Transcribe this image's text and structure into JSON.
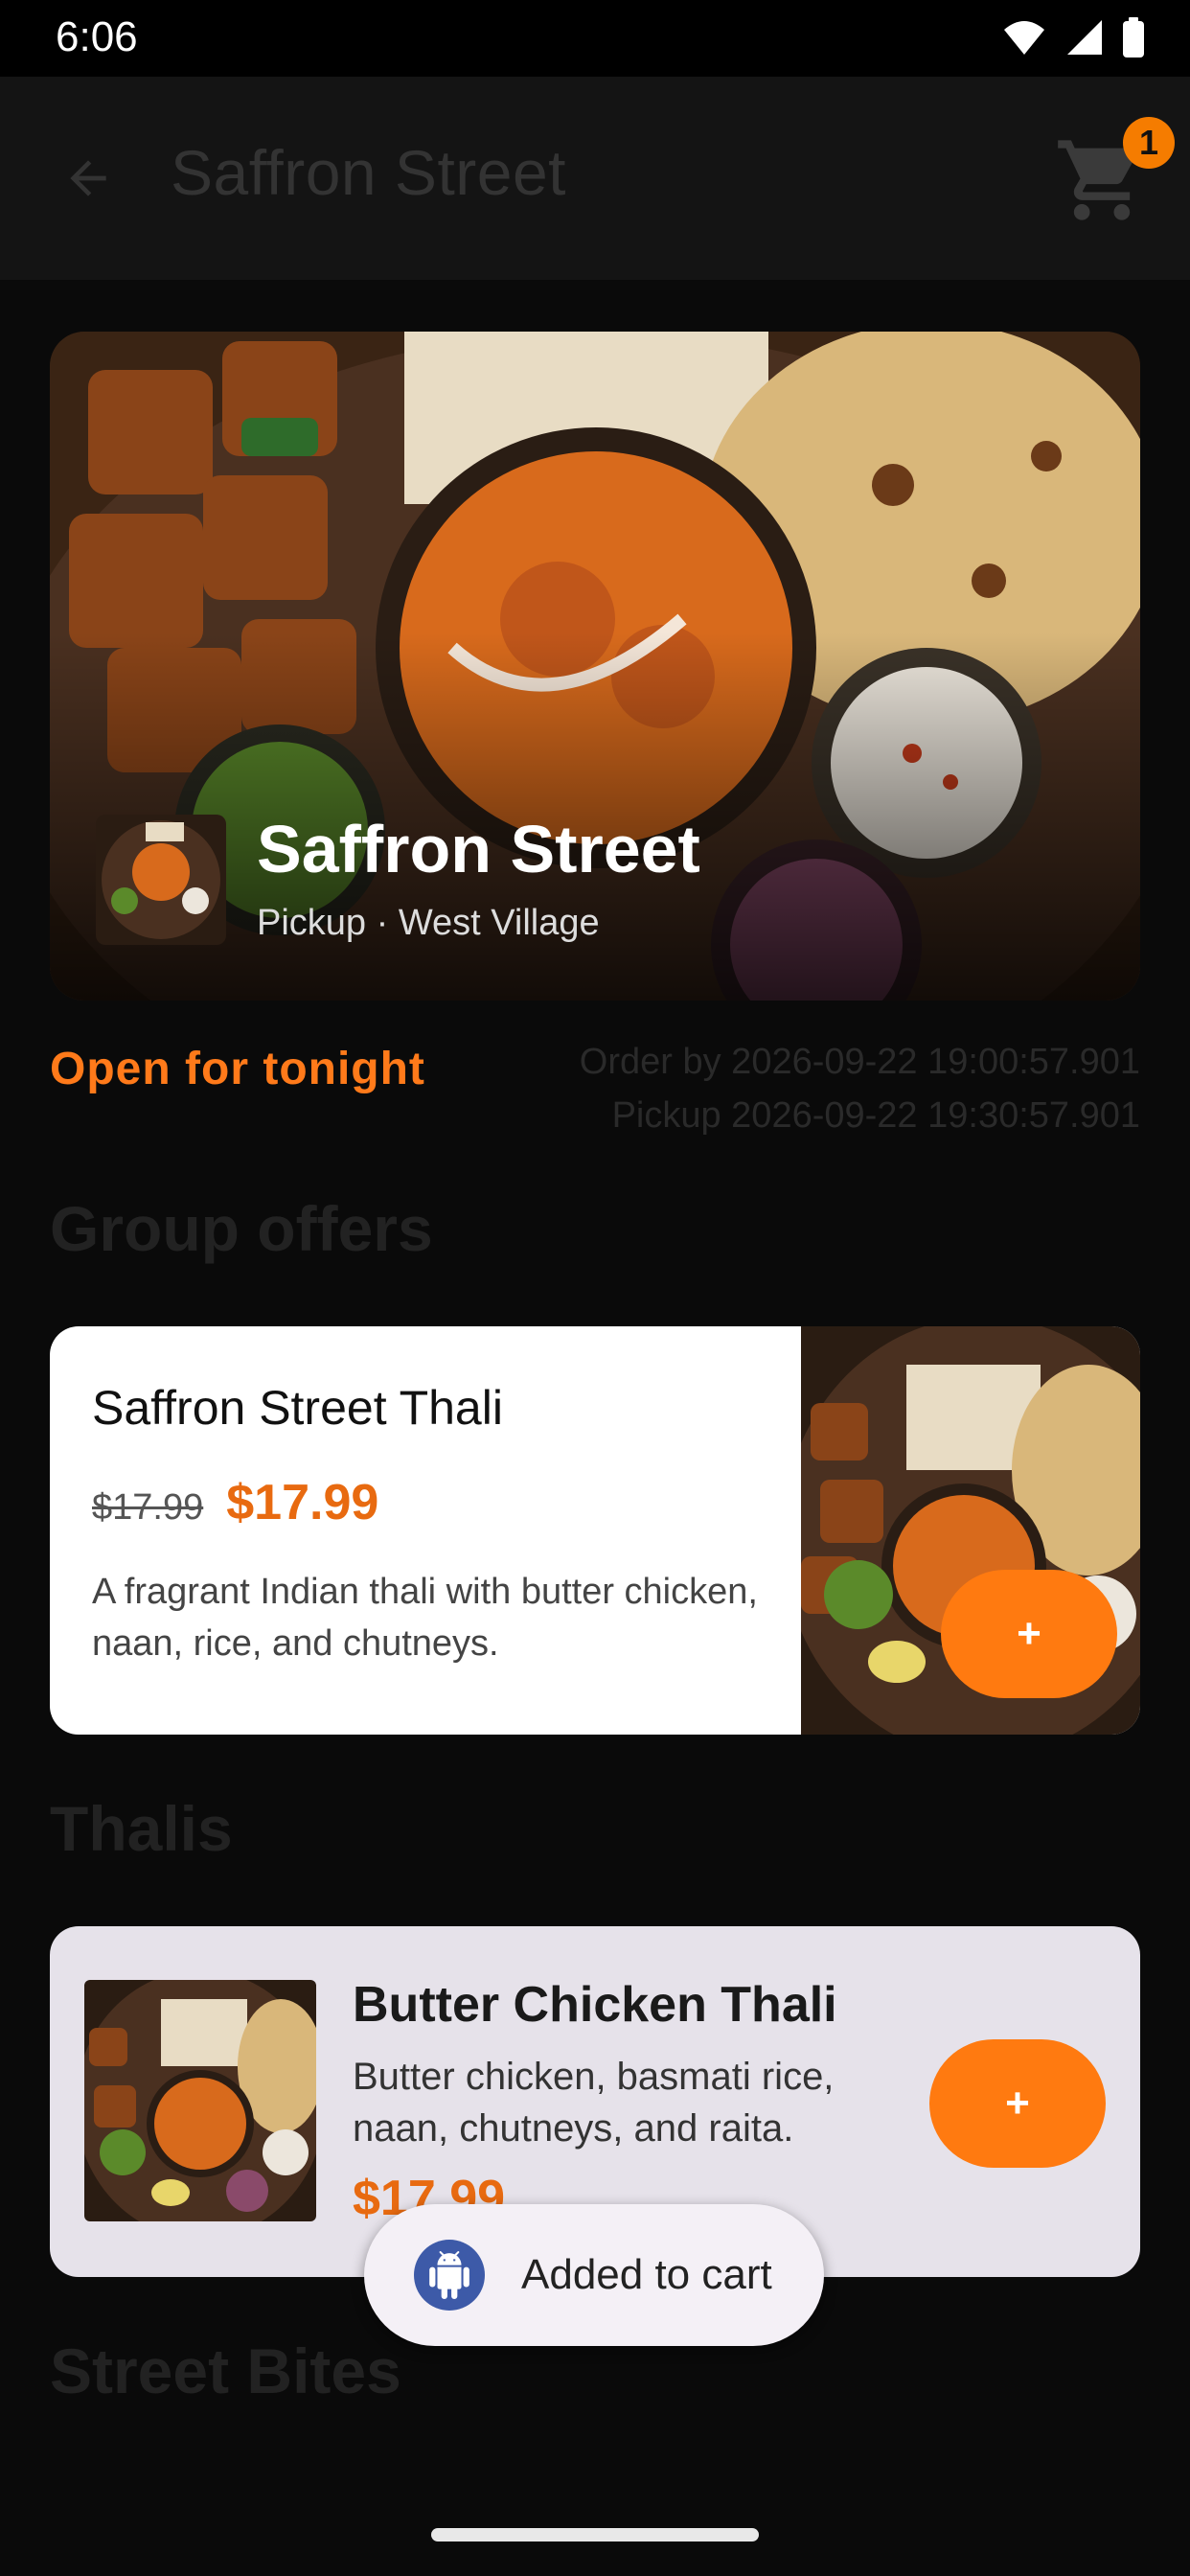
{
  "status_bar": {
    "time": "6:06",
    "icons": [
      "wifi-icon",
      "signal-icon",
      "battery-icon"
    ]
  },
  "app_bar": {
    "title": "Saffron Street",
    "cart_count": "1",
    "back_icon": "arrow-back-icon",
    "cart_icon": "cart-icon"
  },
  "hero": {
    "name": "Saffron Street",
    "subtitle": "Pickup · West Village"
  },
  "availability": {
    "status": "Open for tonight",
    "order_by": "Order by 2026-09-22 19:00:57.901",
    "pickup": "Pickup 2026-09-22 19:30:57.901"
  },
  "sections": {
    "group_offers": "Group offers",
    "thalis": "Thalis",
    "street_bites": "Street Bites"
  },
  "offer": {
    "title": "Saffron Street Thali",
    "old_price": "$17.99",
    "price": "$17.99",
    "description": "A fragrant Indian thali with butter chicken, naan, rice, and chutneys.",
    "add_label": "+"
  },
  "thali_item": {
    "title": "Butter Chicken Thali",
    "description": "Butter chicken, basmati rice, naan, chutneys, and raita.",
    "price": "$17.99",
    "add_label": "+"
  },
  "toast": {
    "message": "Added to cart"
  },
  "colors": {
    "accent": "#ff7a10",
    "price": "#e86a10",
    "background": "#0a0a0a",
    "card": "#ffffff",
    "item_card": "#e6e2ea"
  }
}
